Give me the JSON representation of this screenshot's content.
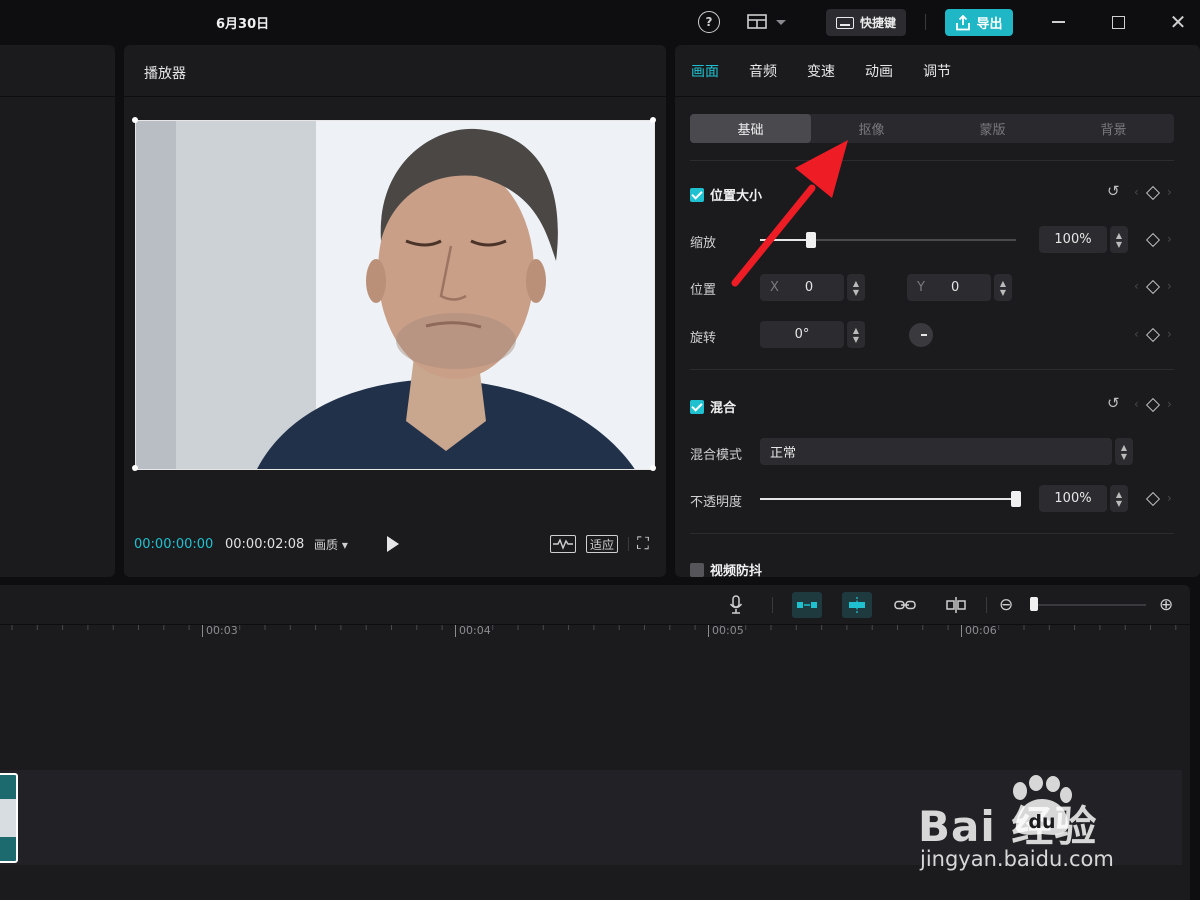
{
  "titlebar": {
    "title": "6月30日",
    "help_glyph": "?",
    "shortcut_label": "快捷键",
    "export_label": "导出",
    "close_glyph": "✕"
  },
  "player": {
    "title": "播放器",
    "timecode_current": "00:00:00:00",
    "timecode_total": "00:00:02:08",
    "quality_label": "画质",
    "quality_caret": "▾",
    "fit_label": "适应",
    "fullscreen_glyph": "⛶"
  },
  "inspector": {
    "tabs": [
      {
        "label": "画面",
        "active": true
      },
      {
        "label": "音频",
        "active": false
      },
      {
        "label": "变速",
        "active": false
      },
      {
        "label": "动画",
        "active": false
      },
      {
        "label": "调节",
        "active": false
      }
    ],
    "subtabs": [
      {
        "label": "基础",
        "active": true
      },
      {
        "label": "抠像",
        "active": false
      },
      {
        "label": "蒙版",
        "active": false
      },
      {
        "label": "背景",
        "active": false
      }
    ],
    "position_size": {
      "title": "位置大小",
      "checked": true,
      "scale_label": "缩放",
      "scale_value": "100%",
      "scale_fraction": 0.2,
      "position_label": "位置",
      "x_label": "X",
      "x_value": "0",
      "y_label": "Y",
      "y_value": "0",
      "rotate_label": "旋转",
      "rotate_value": "0°"
    },
    "blend": {
      "title": "混合",
      "checked": true,
      "mode_label": "混合模式",
      "mode_value": "正常",
      "opacity_label": "不透明度",
      "opacity_value": "100%",
      "opacity_fraction": 1.0
    },
    "stabilize": {
      "title": "视频防抖",
      "checked": false
    },
    "glyphs": {
      "reset": "↺",
      "arrow_left": "‹",
      "arrow_right": "›",
      "step_up": "▲",
      "step_down": "▼"
    }
  },
  "timeline": {
    "ticks": [
      "00:03",
      "00:04",
      "00:05",
      "00:06"
    ],
    "zoom_out_glyph": "⊖",
    "zoom_in_glyph": "⊕"
  },
  "watermark": {
    "brand": "Bai  经验",
    "du": "du",
    "url": "jingyan.baidu.com"
  },
  "colors": {
    "accent": "#1fc1d0",
    "export_button": "#1fb6c6",
    "panel": "#1b1b1e",
    "background": "#0e0e10",
    "annotation_arrow": "#ee1c24"
  }
}
